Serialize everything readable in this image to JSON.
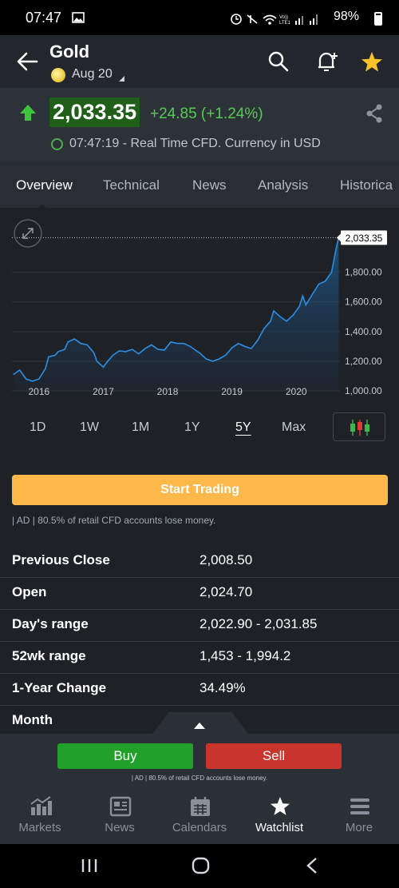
{
  "status_bar": {
    "time": "07:47",
    "carrier": "Vo)) LTE1",
    "battery": "98%"
  },
  "header": {
    "title": "Gold",
    "date": "Aug 20"
  },
  "price": {
    "last": "2,033.35",
    "change": "+24.85 (+1.24%)",
    "realtime_info": "07:47:19 - Real Time CFD. Currency in USD",
    "direction": "up",
    "colors": {
      "up": "#55cc55",
      "price_bg": "#1f5f1a"
    }
  },
  "tabs": [
    "Overview",
    "Technical",
    "News",
    "Analysis",
    "Historica"
  ],
  "active_tab": "Overview",
  "chart_data": {
    "type": "area",
    "x_labels": [
      "2016",
      "2017",
      "2018",
      "2019",
      "2020"
    ],
    "y_ticks": [
      "1,000.00",
      "1,200.00",
      "1,400.00",
      "1,600.00",
      "1,800.00"
    ],
    "ylim": [
      1000,
      2100
    ],
    "current_label": "2,033.35",
    "series": [
      {
        "points": [
          [
            2015.6,
            1110
          ],
          [
            2015.7,
            1140
          ],
          [
            2015.8,
            1080
          ],
          [
            2015.9,
            1065
          ],
          [
            2016.0,
            1080
          ],
          [
            2016.1,
            1150
          ],
          [
            2016.15,
            1230
          ],
          [
            2016.25,
            1240
          ],
          [
            2016.3,
            1265
          ],
          [
            2016.4,
            1280
          ],
          [
            2016.45,
            1330
          ],
          [
            2016.55,
            1350
          ],
          [
            2016.65,
            1320
          ],
          [
            2016.75,
            1310
          ],
          [
            2016.85,
            1260
          ],
          [
            2016.9,
            1200
          ],
          [
            2017.0,
            1160
          ],
          [
            2017.05,
            1190
          ],
          [
            2017.15,
            1240
          ],
          [
            2017.25,
            1270
          ],
          [
            2017.35,
            1265
          ],
          [
            2017.45,
            1280
          ],
          [
            2017.55,
            1250
          ],
          [
            2017.65,
            1285
          ],
          [
            2017.75,
            1310
          ],
          [
            2017.85,
            1280
          ],
          [
            2017.95,
            1275
          ],
          [
            2018.05,
            1330
          ],
          [
            2018.15,
            1320
          ],
          [
            2018.25,
            1320
          ],
          [
            2018.35,
            1300
          ],
          [
            2018.5,
            1255
          ],
          [
            2018.6,
            1215
          ],
          [
            2018.7,
            1200
          ],
          [
            2018.8,
            1215
          ],
          [
            2018.9,
            1240
          ],
          [
            2019.0,
            1290
          ],
          [
            2019.1,
            1320
          ],
          [
            2019.2,
            1300
          ],
          [
            2019.3,
            1285
          ],
          [
            2019.4,
            1340
          ],
          [
            2019.5,
            1420
          ],
          [
            2019.6,
            1470
          ],
          [
            2019.65,
            1540
          ],
          [
            2019.75,
            1500
          ],
          [
            2019.85,
            1470
          ],
          [
            2019.95,
            1510
          ],
          [
            2020.05,
            1570
          ],
          [
            2020.1,
            1640
          ],
          [
            2020.15,
            1580
          ],
          [
            2020.25,
            1650
          ],
          [
            2020.35,
            1720
          ],
          [
            2020.45,
            1740
          ],
          [
            2020.55,
            1800
          ],
          [
            2020.62,
            1960
          ],
          [
            2020.66,
            2033.35
          ]
        ]
      }
    ]
  },
  "ranges": [
    "1D",
    "1W",
    "1M",
    "1Y",
    "5Y",
    "Max"
  ],
  "selected_range": "5Y",
  "start_trading": "Start Trading",
  "ad_disclaimer": "| AD | 80.5% of retail CFD accounts lose money.",
  "stats": [
    {
      "label": "Previous Close",
      "value": "2,008.50"
    },
    {
      "label": "Open",
      "value": "2,024.70"
    },
    {
      "label": "Day's range",
      "value": "2,022.90 - 2,031.85"
    },
    {
      "label": "52wk range",
      "value": "1,453 - 1,994.2"
    },
    {
      "label": "1-Year Change",
      "value": "34.49%"
    },
    {
      "label": "Month",
      "value": ""
    }
  ],
  "trade": {
    "buy": "Buy",
    "sell": "Sell",
    "ad": "| AD | 80.5% of retail CFD accounts lose money."
  },
  "bottom_nav": [
    {
      "label": "Markets",
      "icon": "markets-chart-icon"
    },
    {
      "label": "News",
      "icon": "news-icon"
    },
    {
      "label": "Calendars",
      "icon": "calendar-icon"
    },
    {
      "label": "Watchlist",
      "icon": "star-icon",
      "active": true
    },
    {
      "label": "More",
      "icon": "menu-icon"
    }
  ]
}
